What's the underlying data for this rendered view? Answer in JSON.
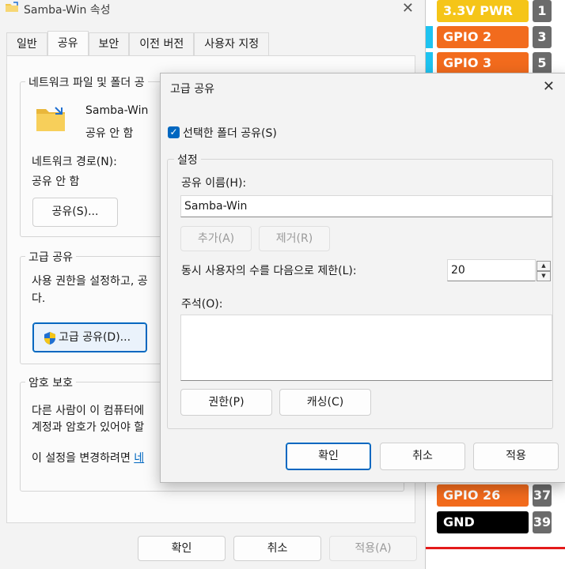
{
  "pinout": {
    "items": [
      {
        "label": "3.3V PWR",
        "num": "1",
        "color": "#f5c518"
      },
      {
        "label": "GPIO 2",
        "num": "3",
        "color": "#f26b1d"
      },
      {
        "label": "GPIO 3",
        "num": "5",
        "color": "#f26b1d"
      },
      {
        "label": "GPIO 26",
        "num": "37",
        "color": "#f26b1d"
      },
      {
        "label": "GND",
        "num": "39",
        "color": "#000000"
      }
    ]
  },
  "props_window": {
    "title": "Samba-Win 속성",
    "tabs": [
      "일반",
      "공유",
      "보안",
      "이전 버전",
      "사용자 지정"
    ],
    "network_group": {
      "label": "네트워크 파일 및 폴더 공",
      "folder_name": "Samba-Win",
      "share_status": "공유 안 함",
      "network_path_label": "네트워크 경로(N):",
      "network_path_value": "공유 안 함",
      "share_button": "공유(S)..."
    },
    "advanced_group": {
      "label": "고급 공유",
      "desc_line1": "사용 권한을 설정하고, 공",
      "desc_line2": "다.",
      "button": "고급 공유(D)..."
    },
    "password_group": {
      "label": "암호 보호",
      "desc_line1": "다른 사람이 이 컴퓨터에",
      "desc_line2": "계정과 암호가 있어야 할",
      "change_prefix": "이 설정을 변경하려면 ",
      "change_link": "네"
    },
    "buttons": {
      "ok": "확인",
      "cancel": "취소",
      "apply": "적용(A)"
    }
  },
  "advanced_dialog": {
    "title": "고급 공유",
    "share_checkbox": {
      "label": "선택한 폴더 공유(S)",
      "checked": true
    },
    "settings_label": "설정",
    "share_name_label": "공유 이름(H):",
    "share_name_value": "Samba-Win",
    "add_button": "추가(A)",
    "remove_button": "제거(R)",
    "limit_label": "동시 사용자의 수를 다음으로 제한(L):",
    "limit_value": "20",
    "comment_label": "주석(O):",
    "comment_value": "",
    "permissions_button": "권한(P)",
    "caching_button": "캐싱(C)",
    "ok": "확인",
    "cancel": "취소",
    "apply": "적용"
  }
}
